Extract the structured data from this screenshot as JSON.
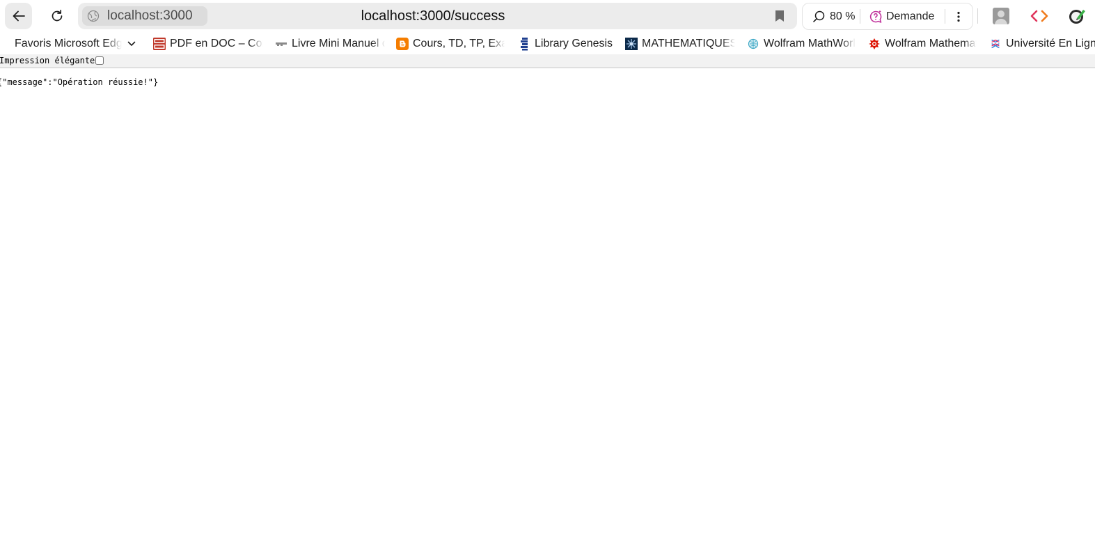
{
  "browser": {
    "site_chip": "localhost:3000",
    "url": "localhost:3000/success",
    "zoom": "80 %",
    "ask_label": "Demande",
    "accent_ask": "#c2379e"
  },
  "bookmarks": [
    {
      "label": "Favoris Microsoft Edge",
      "icon": "none"
    },
    {
      "label": "PDF en DOC – Convertir",
      "icon": "pdf-doc-icon"
    },
    {
      "label": "Livre Mini Manuel de",
      "icon": "book-icon"
    },
    {
      "label": "Cours, TD, TP, Exams",
      "icon": "blogger-icon"
    },
    {
      "label": "Library Genesis",
      "icon": "library-genesis-icon"
    },
    {
      "label": "MATHEMATIQUES",
      "icon": "math-star-icon"
    },
    {
      "label": "Wolfram MathWorld",
      "icon": "mathworld-icon"
    },
    {
      "label": "Wolfram Mathematica",
      "icon": "wolfram-icon"
    },
    {
      "label": "Université En Ligne",
      "icon": "uel-icon"
    }
  ],
  "page": {
    "pretty_print_label": "Impression élégante",
    "pretty_print_checked": false,
    "json_body": "{\"message\":\"Opération réussie!\"}"
  }
}
